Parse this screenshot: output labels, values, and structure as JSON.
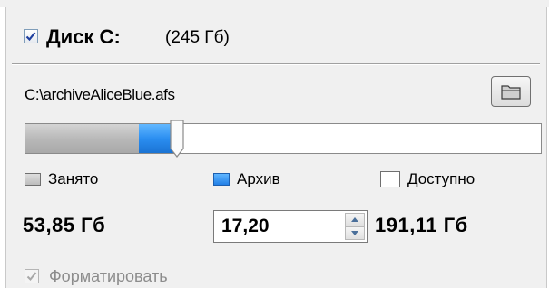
{
  "disk": {
    "checked": true,
    "label": "Диск C:",
    "size": "(245 Гб)"
  },
  "archive_path": "C:\\archiveAliceBlue.afs",
  "icons": {
    "folder_button": "folder-icon",
    "disk_checkbox": "checkmark-icon"
  },
  "usage_bar": {
    "used_fraction": 0.2198,
    "archive_fraction": 0.0702,
    "colors": {
      "used": "#b9b9b9",
      "archive": "#2b8ef1",
      "available": "#ffffff"
    }
  },
  "legend": {
    "used_label": "Занято",
    "archive_label": "Архив",
    "available_label": "Доступно"
  },
  "values": {
    "used": "53,85 Гб",
    "archive": "17,20",
    "available": "191,11 Гб"
  },
  "format": {
    "checked": true,
    "disabled": true,
    "label": "Форматировать"
  }
}
